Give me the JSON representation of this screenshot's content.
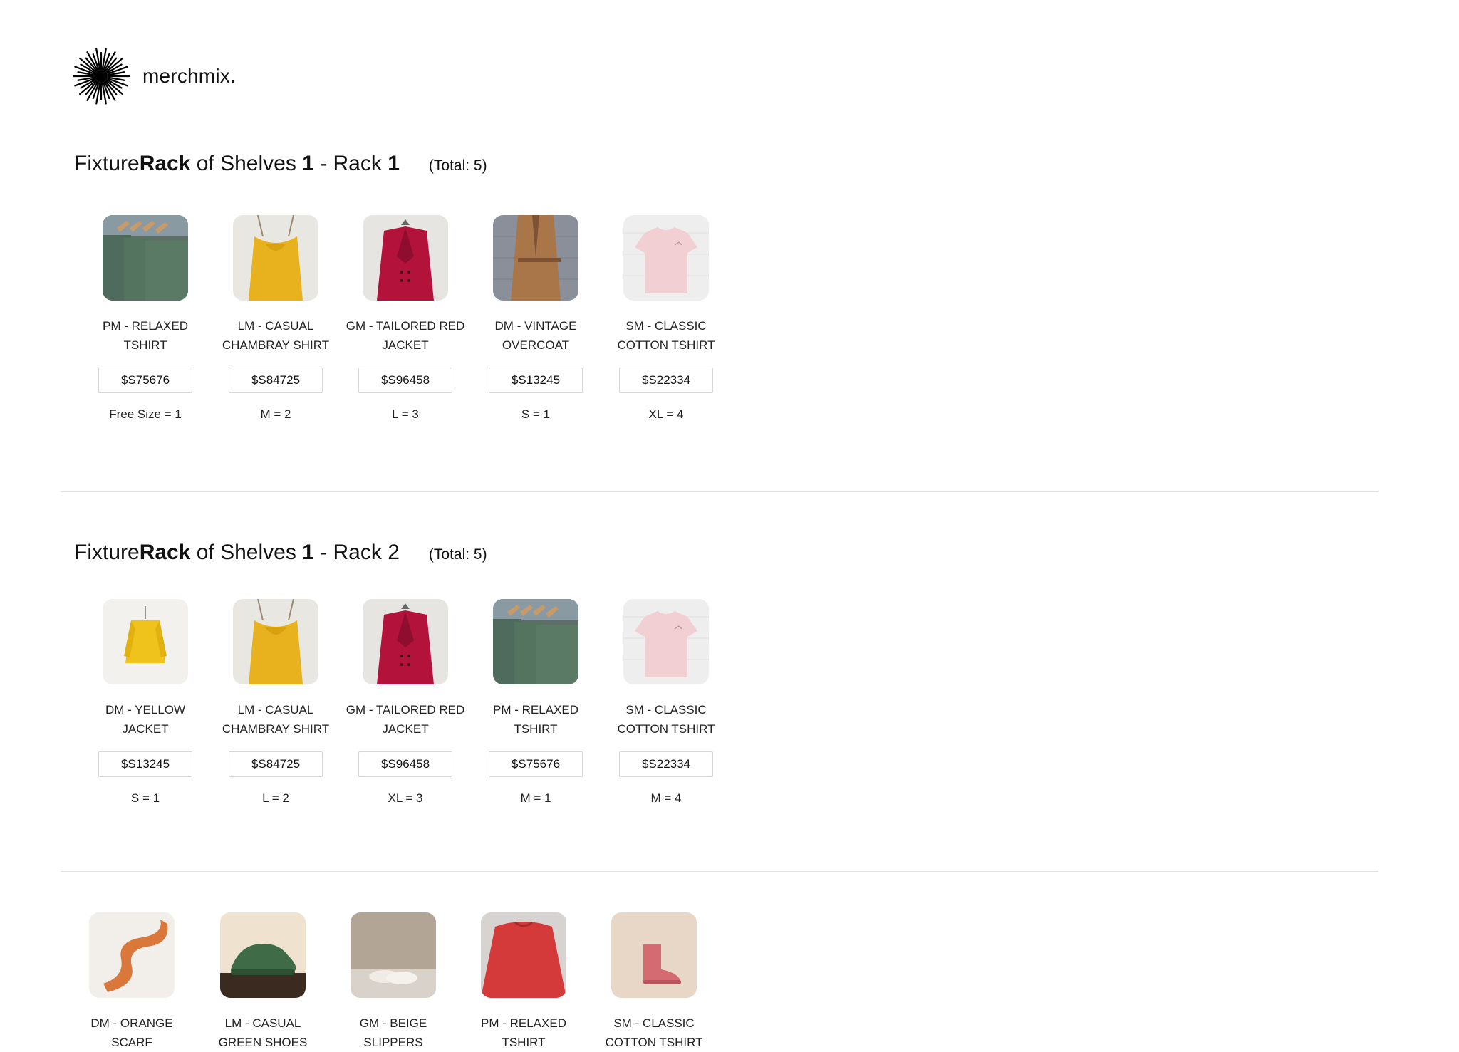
{
  "brand": {
    "name": "merchmix."
  },
  "sections": [
    {
      "title_pre": "Fixture ",
      "title_bold1": "Rack",
      "title_mid": " of Shelves ",
      "title_bold2": "1",
      "title_post": " - Rack ",
      "title_bold3": "1",
      "total": "(Total: 5)",
      "items": [
        {
          "name": "PM - RELAXED TSHIRT",
          "sku": "$S75676",
          "qty": "Free Size = 1",
          "thumb": "green-tshirts-image"
        },
        {
          "name": "LM - CASUAL CHAMBRAY SHIRT",
          "sku": "$S84725",
          "qty": "M = 2",
          "thumb": "yellow-top-image"
        },
        {
          "name": "GM - TAILORED RED JACKET",
          "sku": "$S96458",
          "qty": "L = 3",
          "thumb": "red-jacket-image"
        },
        {
          "name": "DM - VINTAGE OVERCOAT",
          "sku": "$S13245",
          "qty": "S = 1",
          "thumb": "brown-overcoat-image"
        },
        {
          "name": "SM - CLASSIC COTTON TSHIRT",
          "sku": "$S22334",
          "qty": "XL = 4",
          "thumb": "pink-tshirt-image"
        }
      ]
    },
    {
      "title_pre": "Fixture ",
      "title_bold1": "Rack",
      "title_mid": " of Shelves ",
      "title_bold2": "1",
      "title_post": " - Rack 2",
      "title_bold3": "",
      "total": "(Total: 5)",
      "items": [
        {
          "name": "DM - YELLOW JACKET",
          "sku": "$S13245",
          "qty": "S = 1",
          "thumb": "yellow-jacket-image"
        },
        {
          "name": "LM - CASUAL CHAMBRAY SHIRT",
          "sku": "$S84725",
          "qty": "L = 2",
          "thumb": "yellow-top-image"
        },
        {
          "name": "GM - TAILORED RED JACKET",
          "sku": "$S96458",
          "qty": "XL = 3",
          "thumb": "red-jacket-image"
        },
        {
          "name": "PM - RELAXED TSHIRT",
          "sku": "$S75676",
          "qty": "M = 1",
          "thumb": "green-tshirts-image"
        },
        {
          "name": "SM - CLASSIC COTTON TSHIRT",
          "sku": "$S22334",
          "qty": "M = 4",
          "thumb": "pink-tshirt-image"
        }
      ]
    },
    {
      "items": [
        {
          "name": "DM - ORANGE SCARF",
          "thumb": "orange-scarf-image"
        },
        {
          "name": "LM - CASUAL GREEN SHOES",
          "thumb": "green-shoes-image"
        },
        {
          "name": "GM - BEIGE SLIPPERS",
          "thumb": "beige-slippers-image"
        },
        {
          "name": "PM - RELAXED TSHIRT",
          "thumb": "red-tshirt-image"
        },
        {
          "name": "SM - CLASSIC COTTON TSHIRT",
          "thumb": "pink-boot-image"
        }
      ]
    }
  ]
}
